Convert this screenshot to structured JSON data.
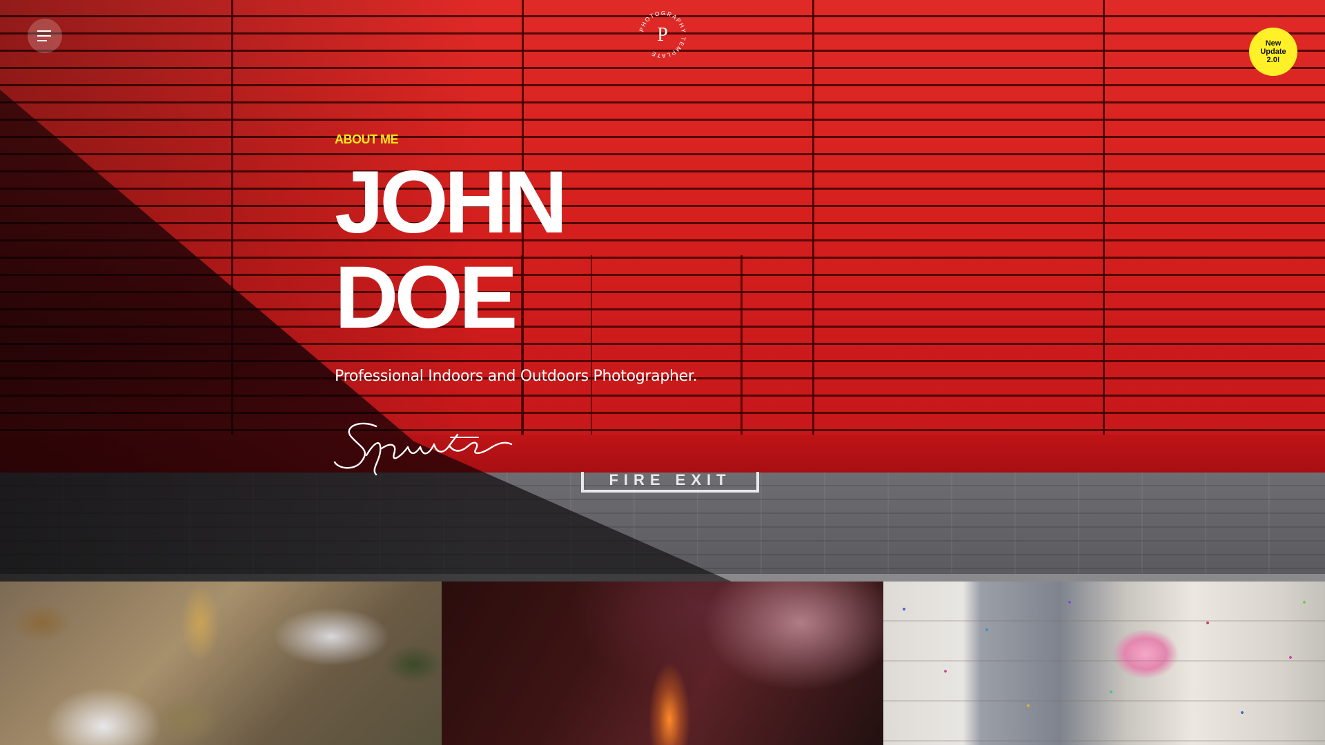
{
  "header": {
    "menu_icon": "hamburger-menu-icon",
    "logo": {
      "letter": "P",
      "ring_text": "PHOTOGRAPHY TEMPLATE"
    },
    "badge": {
      "line1": "New",
      "line2": "Update",
      "line3": "2.0!",
      "color": "#fff027"
    }
  },
  "hero": {
    "eyebrow": "ABOUT ME",
    "name_line1": "JOHN",
    "name_line2": "DOE",
    "tagline": "Professional Indoors and Outdoors Photographer.",
    "signature": "Signature",
    "wall_sign": "FIRE EXIT",
    "accent_color": "#ffe81a"
  },
  "gallery": {
    "tiles": [
      {
        "subject": "river-stones-photo"
      },
      {
        "subject": "canyon-photo"
      },
      {
        "subject": "wedding-couple-photo"
      }
    ]
  }
}
